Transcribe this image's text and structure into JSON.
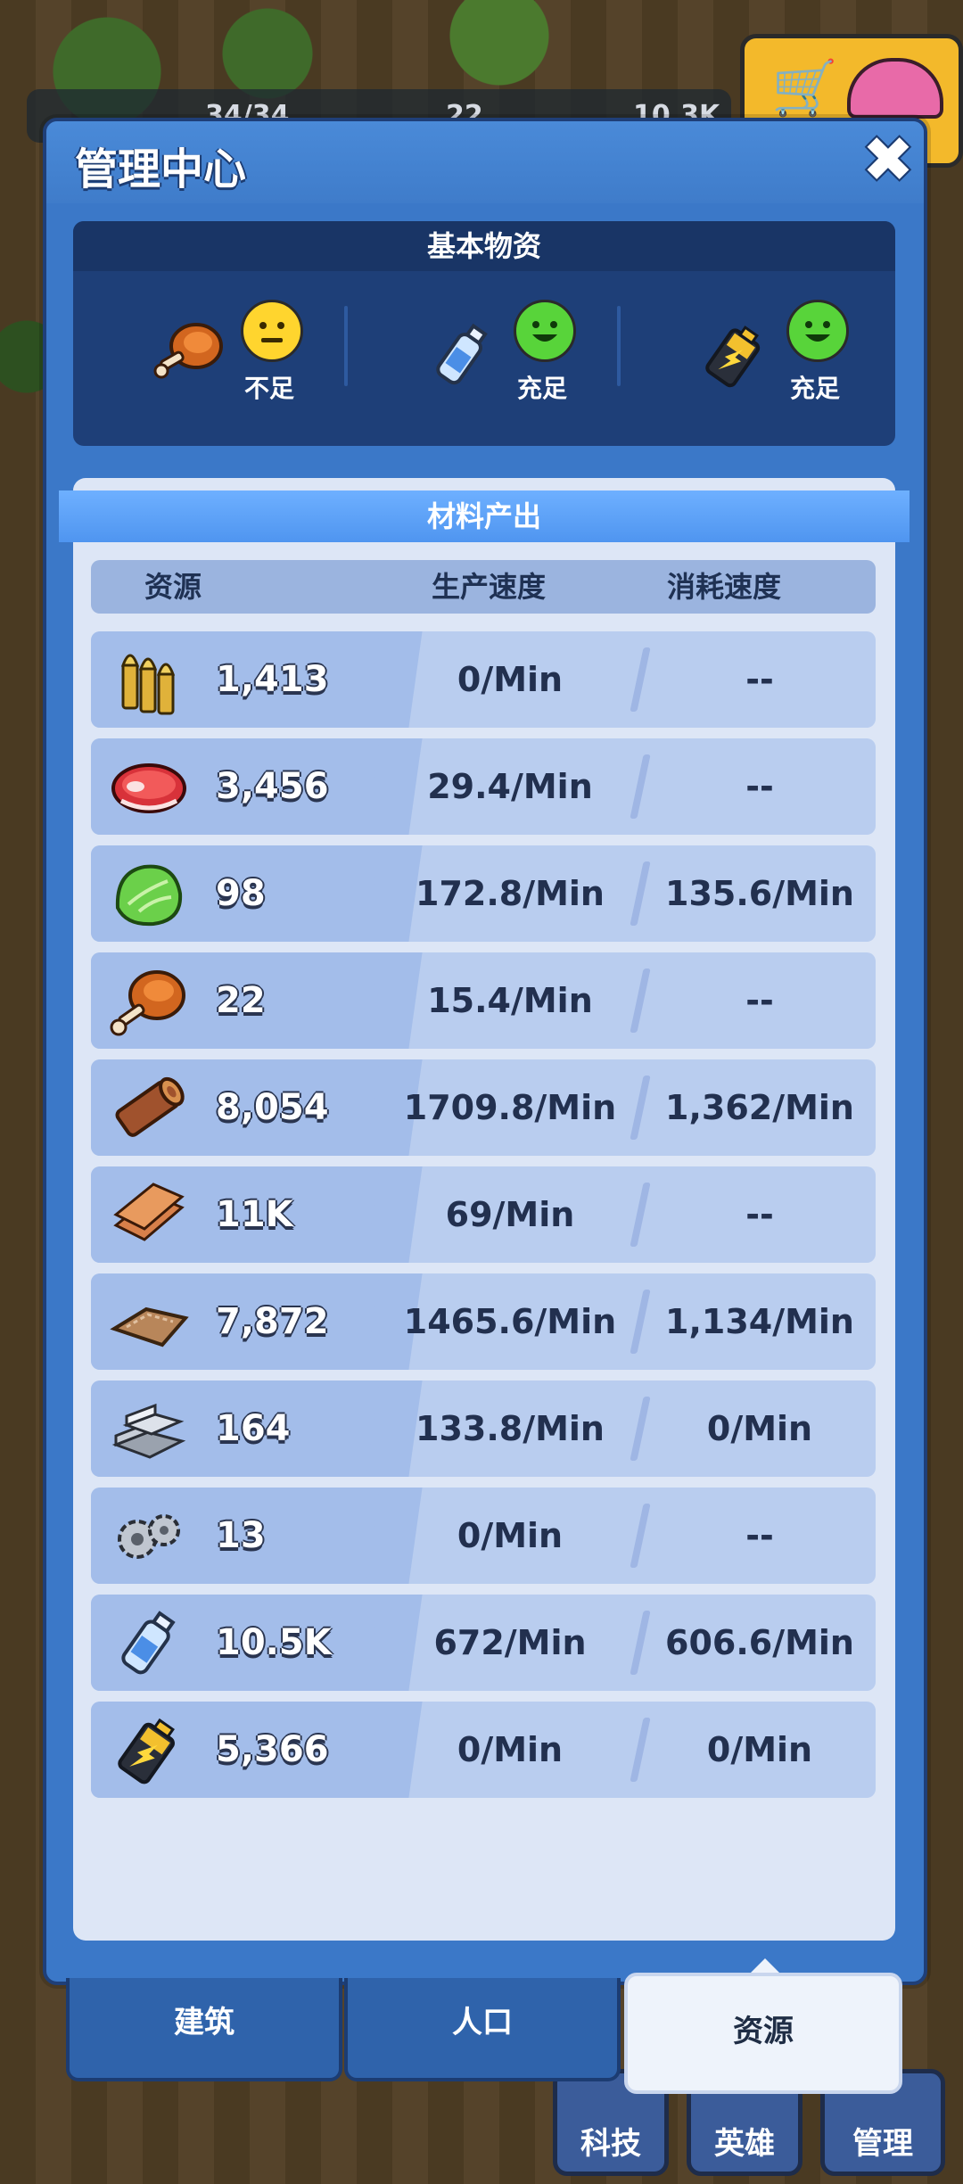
{
  "background": {
    "topbar": [
      "34/34",
      "22",
      "10.3K"
    ],
    "bottom_buttons": [
      "科技",
      "英雄",
      "管理"
    ]
  },
  "modal": {
    "title": "管理中心",
    "close_label": "✖"
  },
  "basic_supplies": {
    "title": "基本物资",
    "items": [
      {
        "icon": "meat-drumstick-icon",
        "status": "不足",
        "face": "neutral"
      },
      {
        "icon": "water-bottle-icon",
        "status": "充足",
        "face": "happy"
      },
      {
        "icon": "battery-icon",
        "status": "充足",
        "face": "happy"
      }
    ]
  },
  "materials": {
    "title": "材料产出",
    "headers": [
      "资源",
      "生产速度",
      "消耗速度"
    ],
    "rows": [
      {
        "icon": "bullets-icon",
        "count": "1,413",
        "production": "0/Min",
        "consumption": "--"
      },
      {
        "icon": "raw-steak-icon",
        "count": "3,456",
        "production": "29.4/Min",
        "consumption": "--"
      },
      {
        "icon": "lettuce-icon",
        "count": "98",
        "production": "172.8/Min",
        "consumption": "135.6/Min"
      },
      {
        "icon": "meat-drumstick-icon",
        "count": "22",
        "production": "15.4/Min",
        "consumption": "--"
      },
      {
        "icon": "wood-log-icon",
        "count": "8,054",
        "production": "1709.8/Min",
        "consumption": "1,362/Min"
      },
      {
        "icon": "wood-planks-icon",
        "count": "11K",
        "production": "69/Min",
        "consumption": "--"
      },
      {
        "icon": "leather-icon",
        "count": "7,872",
        "production": "1465.6/Min",
        "consumption": "1,134/Min"
      },
      {
        "icon": "steel-ingots-icon",
        "count": "164",
        "production": "133.8/Min",
        "consumption": "0/Min"
      },
      {
        "icon": "gears-icon",
        "count": "13",
        "production": "0/Min",
        "consumption": "--"
      },
      {
        "icon": "water-bottle-icon",
        "count": "10.5K",
        "production": "672/Min",
        "consumption": "606.6/Min"
      },
      {
        "icon": "battery-icon",
        "count": "5,366",
        "production": "0/Min",
        "consumption": "0/Min"
      }
    ]
  },
  "tabs": [
    {
      "label": "建筑",
      "active": false
    },
    {
      "label": "人口",
      "active": false
    },
    {
      "label": "资源",
      "active": true
    }
  ]
}
